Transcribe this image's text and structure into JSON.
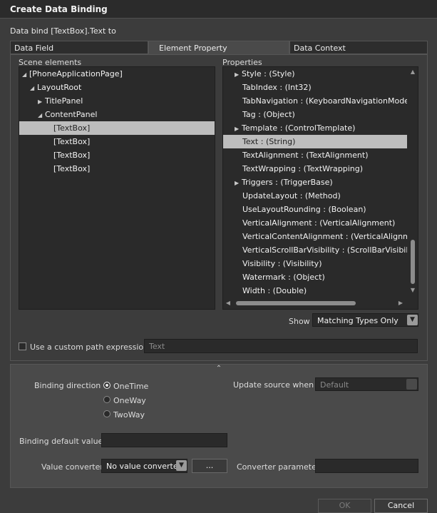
{
  "window": {
    "title": "Create Data Binding"
  },
  "header": {
    "subtitle": "Data bind [TextBox].Text to"
  },
  "tabs": [
    {
      "label": "Data Field"
    },
    {
      "label": "Element Property"
    },
    {
      "label": "Data Context"
    }
  ],
  "scene": {
    "label": "Scene elements",
    "items": [
      {
        "label": "[PhoneApplicationPage]"
      },
      {
        "label": "LayoutRoot"
      },
      {
        "label": "TitlePanel"
      },
      {
        "label": "ContentPanel"
      },
      {
        "label": "[TextBox]"
      },
      {
        "label": "[TextBox]"
      },
      {
        "label": "[TextBox]"
      },
      {
        "label": "[TextBox]"
      }
    ]
  },
  "properties": {
    "label": "Properties",
    "items": [
      {
        "label": "Style : (Style)"
      },
      {
        "label": "TabIndex : (Int32)"
      },
      {
        "label": "TabNavigation : (KeyboardNavigationMode)"
      },
      {
        "label": "Tag : (Object)"
      },
      {
        "label": "Template : (ControlTemplate)"
      },
      {
        "label": "Text : (String)"
      },
      {
        "label": "TextAlignment : (TextAlignment)"
      },
      {
        "label": "TextWrapping : (TextWrapping)"
      },
      {
        "label": "Triggers : (TriggerBase)"
      },
      {
        "label": "UpdateLayout : (Method)"
      },
      {
        "label": "UseLayoutRounding : (Boolean)"
      },
      {
        "label": "VerticalAlignment : (VerticalAlignment)"
      },
      {
        "label": "VerticalContentAlignment : (VerticalAlignmen"
      },
      {
        "label": "VerticalScrollBarVisibility : (ScrollBarVisibility)"
      },
      {
        "label": "Visibility : (Visibility)"
      },
      {
        "label": "Watermark : (Object)"
      },
      {
        "label": "Width : (Double)"
      }
    ]
  },
  "show": {
    "label": "Show",
    "value": "Matching Types Only"
  },
  "custom_path": {
    "label": "Use a custom path expression",
    "placeholder": "Text"
  },
  "binding": {
    "direction_label": "Binding direction",
    "options": [
      {
        "label": "OneTime"
      },
      {
        "label": "OneWay"
      },
      {
        "label": "TwoWay"
      }
    ],
    "update_label": "Update source when",
    "update_value": "Default",
    "default_value_label": "Binding default value",
    "converter_label": "Value converter",
    "converter_value": "No value converter",
    "ellipsis_label": "...",
    "converter_param_label": "Converter parameter"
  },
  "buttons": {
    "ok": "OK",
    "cancel": "Cancel"
  },
  "colors": {
    "background": "#3c3c3c",
    "selection": "#bdbdbd",
    "panel": "#2a2a2a"
  }
}
